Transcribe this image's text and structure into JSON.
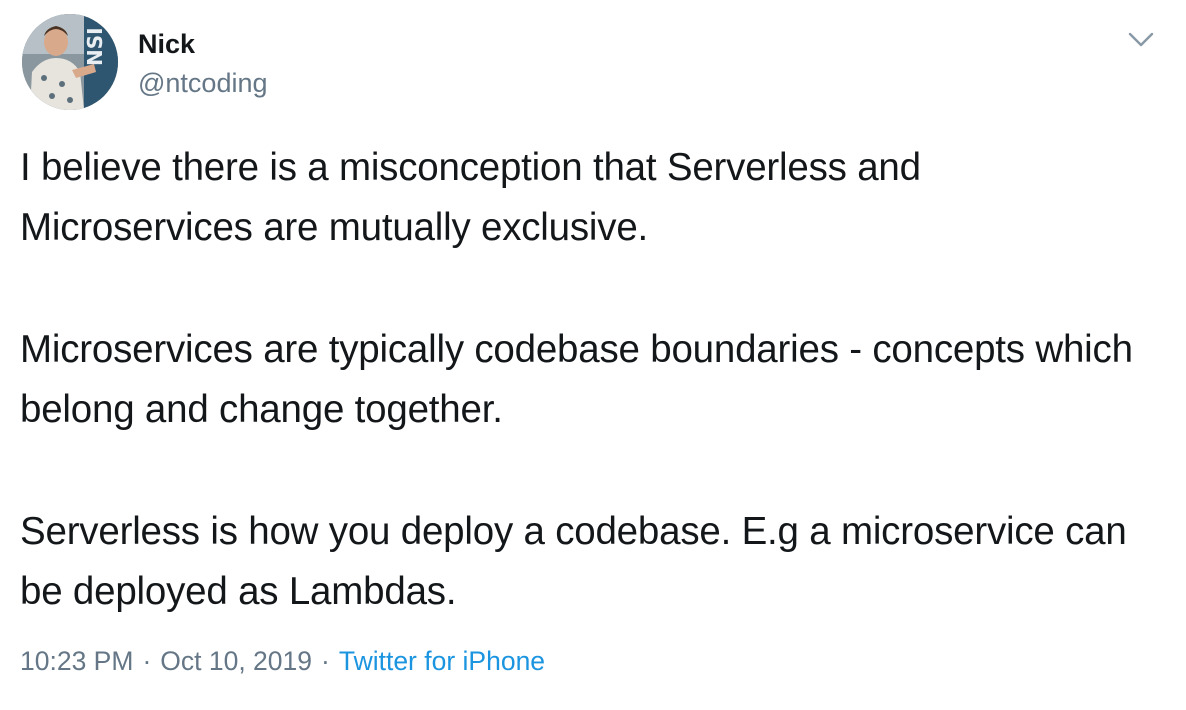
{
  "author": {
    "name": "Nick",
    "handle": "@ntcoding"
  },
  "tweet": {
    "paragraphs": [
      "I believe there is a misconception that Serverless and Microservices are mutually exclusive.",
      "Microservices are typically codebase boundaries - concepts which belong and change together.",
      "Serverless is how you deploy a codebase. E.g a microservice can be deployed as Lambdas."
    ]
  },
  "meta": {
    "time": "10:23 PM",
    "separator": "·",
    "date": "Oct 10, 2019",
    "source": "Twitter for iPhone"
  },
  "icons": {
    "menu": "chevron-down-icon",
    "avatar": "avatar"
  },
  "colors": {
    "text": "#14171a",
    "secondary": "#657786",
    "link": "#1b95e0"
  }
}
